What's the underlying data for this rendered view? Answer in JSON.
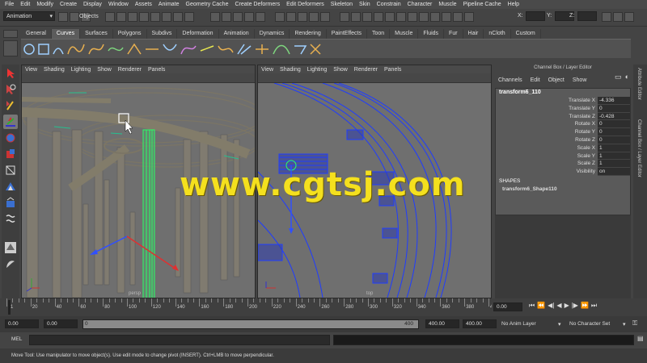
{
  "menubar": [
    "File",
    "Edit",
    "Modify",
    "Create",
    "Display",
    "Window",
    "Assets",
    "Animate",
    "Geometry Cache",
    "Create Deformers",
    "Edit Deformers",
    "Skeleton",
    "Skin",
    "Constrain",
    "Character",
    "Muscle",
    "Pipeline Cache",
    "Help"
  ],
  "status": {
    "mode": "Animation",
    "objects_label": "Objects",
    "x_label": "X:",
    "y_label": "Y:",
    "z_label": "Z:"
  },
  "shelf_tabs": [
    "General",
    "Curves",
    "Surfaces",
    "Polygons",
    "Subdivs",
    "Deformation",
    "Animation",
    "Dynamics",
    "Rendering",
    "PaintEffects",
    "Toon",
    "Muscle",
    "Fluids",
    "Fur",
    "Hair",
    "nCloth",
    "Custom"
  ],
  "shelf_active": "Curves",
  "left_panel": {
    "menus": [
      "View",
      "Shading",
      "Lighting",
      "Show",
      "Renderer",
      "Panels"
    ],
    "camera_label": "persp"
  },
  "right_panel": {
    "menus": [
      "View",
      "Shading",
      "Lighting",
      "Show",
      "Renderer",
      "Panels"
    ],
    "camera_label": "top"
  },
  "channel_box": {
    "title": "Channel Box / Layer Editor",
    "menus": [
      "Channels",
      "Edit",
      "Object",
      "Show"
    ],
    "object_name": "transform6_110",
    "attributes": [
      {
        "name": "Translate X",
        "value": "-4.336"
      },
      {
        "name": "Translate Y",
        "value": "0"
      },
      {
        "name": "Translate Z",
        "value": "-0.428"
      },
      {
        "name": "Rotate X",
        "value": "0"
      },
      {
        "name": "Rotate Y",
        "value": "0"
      },
      {
        "name": "Rotate Z",
        "value": "0"
      },
      {
        "name": "Scale X",
        "value": "1"
      },
      {
        "name": "Scale Y",
        "value": "1"
      },
      {
        "name": "Scale Z",
        "value": "1"
      },
      {
        "name": "Visibility",
        "value": "on"
      }
    ],
    "shapes_label": "SHAPES",
    "shape_name": "transform6_Shape110"
  },
  "side_tabs": [
    "Attribute Editor",
    "Channel Box / Layer Editor"
  ],
  "timeline": {
    "ticks": [
      "1",
      "20",
      "40",
      "60",
      "80",
      "100",
      "120",
      "140",
      "160",
      "180",
      "200",
      "220",
      "240",
      "260",
      "280",
      "300",
      "320",
      "340",
      "360",
      "380",
      "400"
    ],
    "current_frame": "0.00"
  },
  "range": {
    "start": "0.00",
    "playback_start": "0.00",
    "slider_start": "0",
    "slider_end": "400",
    "playback_end": "400.00",
    "end": "400.00",
    "anim_layer": "No Anim Layer",
    "character_set": "No Character Set"
  },
  "command_line": {
    "label": "MEL"
  },
  "help_line": "Move Tool: Use manipulator to move object(s). Use edit mode to change pivot (INSERT). Ctrl+LMB to move perpendicular.",
  "watermark": "www.cgtsj.com",
  "colors": {
    "accent": "#5c5c5c",
    "wire_blue": "#1f3cff",
    "select_green": "#2aff66",
    "watermark": "#f4e01e"
  }
}
